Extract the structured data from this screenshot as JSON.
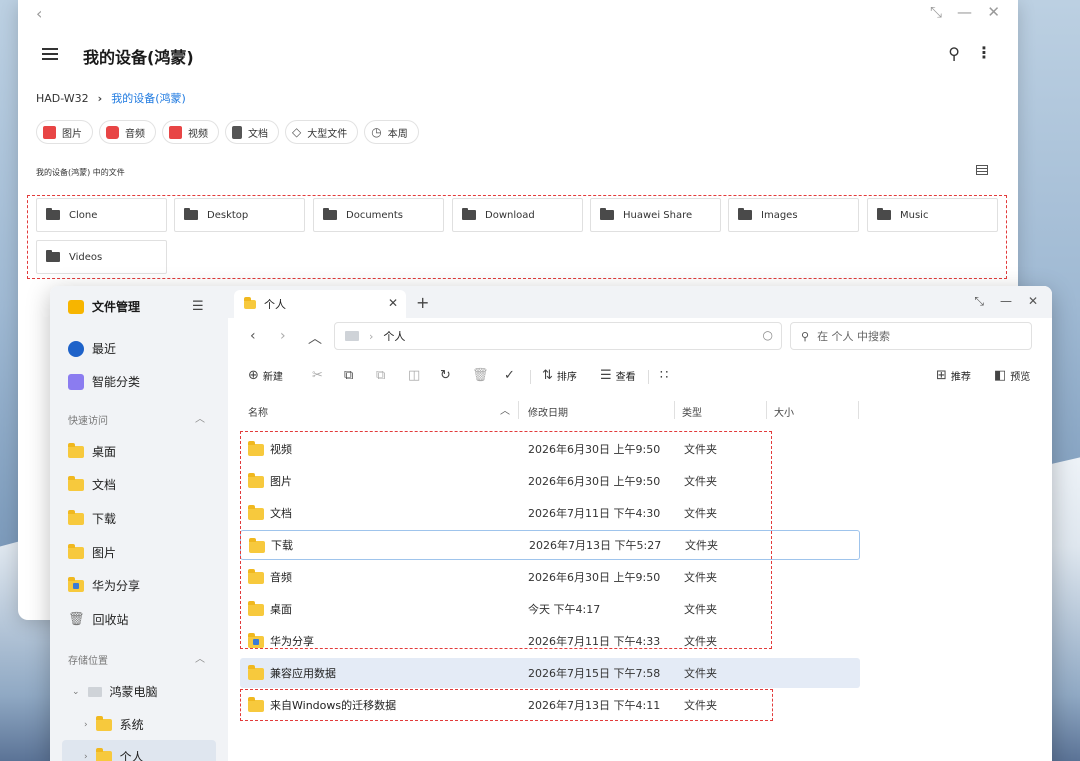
{
  "back_window": {
    "title": "我的设备(鸿蒙)",
    "breadcrumb": {
      "root": "HAD-W32",
      "current": "我的设备(鸿蒙)"
    },
    "chips": [
      {
        "label": "图片",
        "icon": "image-icon",
        "color": "#e84545"
      },
      {
        "label": "音频",
        "icon": "music-icon",
        "color": "#e84545"
      },
      {
        "label": "视频",
        "icon": "video-icon",
        "color": "#e84545"
      },
      {
        "label": "文档",
        "icon": "document-icon",
        "color": "#555555"
      },
      {
        "label": "大型文件",
        "icon": "tag-icon",
        "color": "#555555"
      },
      {
        "label": "本周",
        "icon": "history-icon",
        "color": "#555555"
      }
    ],
    "section_label": "我的设备(鸿蒙) 中的文件",
    "folders": [
      "Clone",
      "Desktop",
      "Documents",
      "Download",
      "Huawei Share",
      "Images",
      "Music",
      "Videos"
    ]
  },
  "front_window": {
    "app_title": "文件管理",
    "sidebar": {
      "top_items": [
        {
          "label": "最近",
          "icon": "clock-icon"
        },
        {
          "label": "智能分类",
          "icon": "category-icon"
        }
      ],
      "quick_access_label": "快速访问",
      "quick_access": [
        {
          "label": "桌面",
          "icon": "desktop-folder-icon"
        },
        {
          "label": "文档",
          "icon": "documents-folder-icon"
        },
        {
          "label": "下载",
          "icon": "download-folder-icon"
        },
        {
          "label": "图片",
          "icon": "pictures-folder-icon"
        },
        {
          "label": "华为分享",
          "icon": "share-folder-icon"
        },
        {
          "label": "回收站",
          "icon": "trash-icon"
        }
      ],
      "storage_label": "存储位置",
      "storage": [
        {
          "label": "鸿蒙电脑",
          "icon": "computer-icon"
        },
        {
          "label": "系统",
          "icon": "folder-icon"
        },
        {
          "label": "个人",
          "icon": "folder-icon"
        }
      ]
    },
    "tab": {
      "label": "个人"
    },
    "address": {
      "path": "个人"
    },
    "search": {
      "placeholder": "在 个人 中搜索"
    },
    "toolbar": {
      "new_label": "新建",
      "sort_label": "排序",
      "view_label": "查看",
      "recommend_label": "推荐",
      "preview_label": "预览"
    },
    "columns": {
      "name": "名称",
      "modified": "修改日期",
      "type": "类型",
      "size": "大小"
    },
    "files": [
      {
        "name": "视频",
        "date": "2026年6月30日 上午9:50",
        "type": "文件夹"
      },
      {
        "name": "图片",
        "date": "2026年6月30日 上午9:50",
        "type": "文件夹"
      },
      {
        "name": "文档",
        "date": "2026年7月11日 下午4:30",
        "type": "文件夹"
      },
      {
        "name": "下载",
        "date": "2026年7月13日 下午5:27",
        "type": "文件夹"
      },
      {
        "name": "音频",
        "date": "2026年6月30日 上午9:50",
        "type": "文件夹"
      },
      {
        "name": "桌面",
        "date": "今天 下午4:17",
        "type": "文件夹"
      },
      {
        "name": "华为分享",
        "date": "2026年7月11日 下午4:33",
        "type": "文件夹"
      },
      {
        "name": "兼容应用数据",
        "date": "2026年7月15日 下午7:58",
        "type": "文件夹"
      },
      {
        "name": "来自Windows的迁移数据",
        "date": "2026年7月13日 下午4:11",
        "type": "文件夹"
      }
    ]
  },
  "colors": {
    "accent": "#1f7ae0",
    "highlight_box": "#e23b3b",
    "folder": "#f7c93d"
  }
}
